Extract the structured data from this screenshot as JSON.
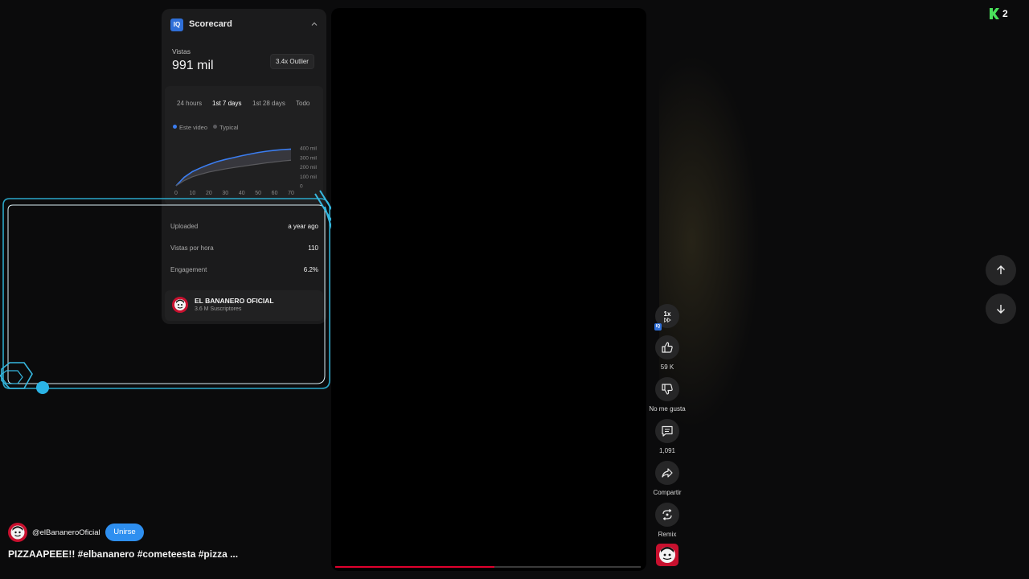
{
  "scorecard": {
    "logo_text": "IQ",
    "title": "Scorecard",
    "views_label": "Vistas",
    "views_value": "991 mil",
    "outlier_badge": "3.4x Outlier",
    "tabs": [
      "24 hours",
      "1st 7 days",
      "1st 28 days",
      "Todo"
    ],
    "active_tab": "1st 7 days",
    "legend": [
      {
        "label": "Este video",
        "color": "#3b7df0"
      },
      {
        "label": "Typical",
        "color": "#5a5a5e"
      }
    ],
    "stats": [
      {
        "label": "Uploaded",
        "value": "a year ago"
      },
      {
        "label": "Vistas por hora",
        "value": "110"
      },
      {
        "label": "Engagement",
        "value": "6.2%"
      }
    ],
    "channel": {
      "name": "EL BANANERO OFICIAL",
      "subscribers": "3.6 M Suscriptores"
    }
  },
  "chart_data": {
    "type": "area",
    "x_ticks": [
      "0",
      "10",
      "20",
      "30",
      "40",
      "50",
      "60",
      "70"
    ],
    "y_ticks": [
      "400 mil",
      "300 mil",
      "200 mil",
      "100 mil",
      "0"
    ],
    "xlim": [
      0,
      70
    ],
    "ylim": [
      0,
      400
    ],
    "series": [
      {
        "name": "Este video",
        "color": "#3b7df0",
        "x": [
          0,
          5,
          10,
          15,
          20,
          25,
          30,
          35,
          40,
          45,
          50,
          55,
          60,
          65,
          70
        ],
        "y": [
          0,
          90,
          150,
          190,
          225,
          255,
          278,
          298,
          318,
          335,
          352,
          365,
          375,
          383,
          388
        ]
      },
      {
        "name": "Typical",
        "color": "#5a5a5e",
        "x": [
          0,
          5,
          10,
          15,
          20,
          25,
          30,
          35,
          40,
          45,
          50,
          55,
          60,
          65,
          70
        ],
        "y": [
          0,
          55,
          95,
          122,
          145,
          162,
          178,
          192,
          205,
          218,
          230,
          242,
          252,
          262,
          270
        ]
      }
    ]
  },
  "video": {
    "progress": 0.52,
    "progress_color": "#e1002d"
  },
  "actions": {
    "speed": {
      "value": "1x",
      "badge": "IQ"
    },
    "like": "59 K",
    "dislike": "No me gusta",
    "comments": "1,091",
    "share": "Compartir",
    "remix": "Remix"
  },
  "top_badge": {
    "count": "2",
    "color": "#49e05a"
  },
  "owner": {
    "handle": "@elBananeroOficial",
    "join_label": "Unirse"
  },
  "video_title": "PIZZAAPEEE!! #elbananero #cometeesta #pizza ..."
}
